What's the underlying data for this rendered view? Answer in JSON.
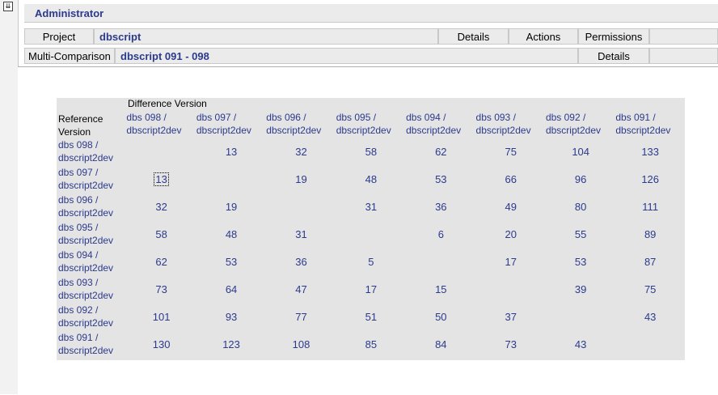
{
  "header": {
    "title": "Administrator"
  },
  "row1": {
    "label": "Project",
    "value": "dbscript",
    "details": "Details",
    "actions": "Actions",
    "permissions": "Permissions"
  },
  "row2": {
    "label": "Multi-Comparison",
    "value": "dbscript 091 - 098",
    "details": "Details"
  },
  "matrix": {
    "difference_label": "Difference Version",
    "reference_label_1": "Reference",
    "reference_label_2": "Version",
    "columns": [
      {
        "line1": "dbs 098 /",
        "line2": "dbscript2dev"
      },
      {
        "line1": "dbs 097 /",
        "line2": "dbscript2dev"
      },
      {
        "line1": "dbs 096 /",
        "line2": "dbscript2dev"
      },
      {
        "line1": "dbs 095 /",
        "line2": "dbscript2dev"
      },
      {
        "line1": "dbs 094 /",
        "line2": "dbscript2dev"
      },
      {
        "line1": "dbs 093 /",
        "line2": "dbscript2dev"
      },
      {
        "line1": "dbs 092 /",
        "line2": "dbscript2dev"
      },
      {
        "line1": "dbs 091 /",
        "line2": "dbscript2dev"
      }
    ],
    "rows": [
      {
        "line1": "dbs 098 /",
        "line2": "dbscript2dev",
        "values": [
          "",
          "13",
          "32",
          "58",
          "62",
          "75",
          "104",
          "133"
        ]
      },
      {
        "line1": "dbs 097 /",
        "line2": "dbscript2dev",
        "values": [
          "13",
          "",
          "19",
          "48",
          "53",
          "66",
          "96",
          "126"
        ]
      },
      {
        "line1": "dbs 096 /",
        "line2": "dbscript2dev",
        "values": [
          "32",
          "19",
          "",
          "31",
          "36",
          "49",
          "80",
          "111"
        ]
      },
      {
        "line1": "dbs 095 /",
        "line2": "dbscript2dev",
        "values": [
          "58",
          "48",
          "31",
          "",
          "6",
          "20",
          "55",
          "89"
        ]
      },
      {
        "line1": "dbs 094 /",
        "line2": "dbscript2dev",
        "values": [
          "62",
          "53",
          "36",
          "5",
          "",
          "17",
          "53",
          "87"
        ]
      },
      {
        "line1": "dbs 093 /",
        "line2": "dbscript2dev",
        "values": [
          "73",
          "64",
          "47",
          "17",
          "15",
          "",
          "39",
          "75"
        ]
      },
      {
        "line1": "dbs 092 /",
        "line2": "dbscript2dev",
        "values": [
          "101",
          "93",
          "77",
          "51",
          "50",
          "37",
          "",
          "43"
        ]
      },
      {
        "line1": "dbs 091 /",
        "line2": "dbscript2dev",
        "values": [
          "130",
          "123",
          "108",
          "85",
          "84",
          "73",
          "43",
          ""
        ]
      }
    ]
  }
}
